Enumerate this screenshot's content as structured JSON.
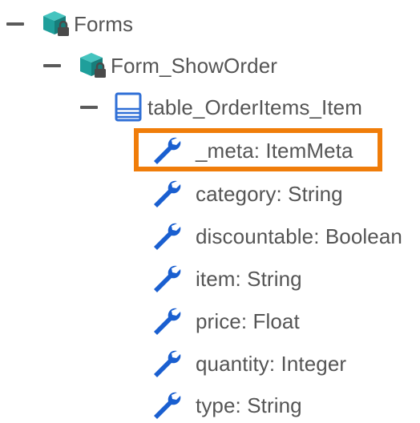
{
  "tree": {
    "nodes": [
      {
        "id": "forms",
        "label": "Forms",
        "icon": "package-lock-icon",
        "expanded": true
      },
      {
        "id": "form_showorder",
        "label": "Form_ShowOrder",
        "icon": "package-lock-icon",
        "expanded": true
      },
      {
        "id": "table_orderitems_item",
        "label": "table_OrderItems_Item",
        "icon": "table-icon",
        "expanded": true
      },
      {
        "id": "meta",
        "label": "_meta: ItemMeta",
        "icon": "wrench-icon",
        "highlighted": true
      },
      {
        "id": "category",
        "label": "category: String",
        "icon": "wrench-icon"
      },
      {
        "id": "discountable",
        "label": "discountable: Boolean",
        "icon": "wrench-icon"
      },
      {
        "id": "item",
        "label": "item: String",
        "icon": "wrench-icon"
      },
      {
        "id": "price",
        "label": "price: Float",
        "icon": "wrench-icon"
      },
      {
        "id": "quantity",
        "label": "quantity: Integer",
        "icon": "wrench-icon"
      },
      {
        "id": "type",
        "label": "type: String",
        "icon": "wrench-icon"
      }
    ]
  },
  "colors": {
    "highlight": "#f07d0a",
    "wrench": "#1a5fd0",
    "table": "#2f6fd6",
    "package_teal": "#21a3a0",
    "lock": "#4a4a4a"
  }
}
